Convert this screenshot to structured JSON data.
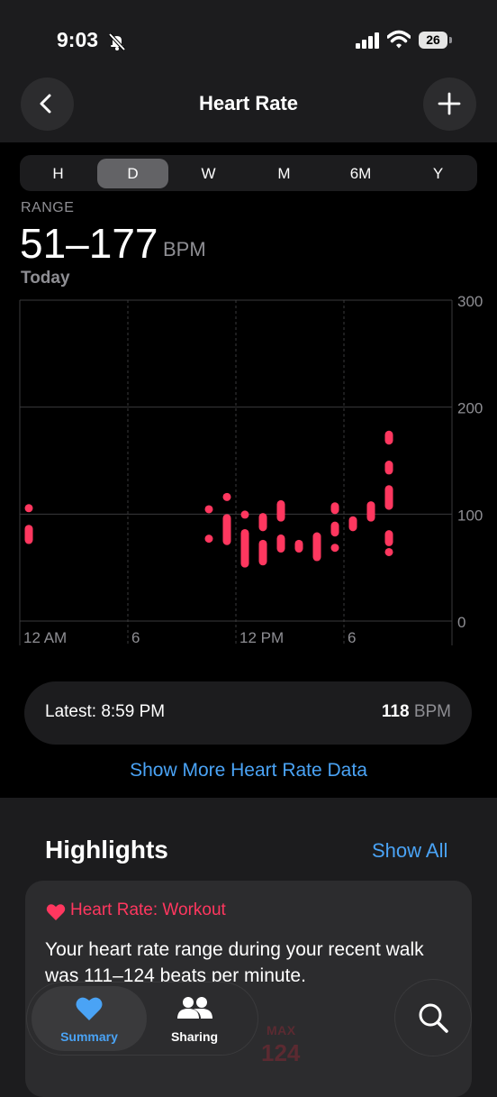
{
  "status_bar": {
    "time": "9:03",
    "battery": "26"
  },
  "nav": {
    "title": "Heart Rate"
  },
  "segments": [
    "H",
    "D",
    "W",
    "M",
    "6M",
    "Y"
  ],
  "active_segment": "D",
  "range": {
    "label": "RANGE",
    "value": "51–177",
    "unit": "BPM",
    "date": "Today"
  },
  "chart_data": {
    "type": "range-bar",
    "x_labels": [
      "12 AM",
      "6",
      "12 PM",
      "6"
    ],
    "y_ticks": [
      0,
      100,
      200,
      300
    ],
    "ylim": [
      0,
      300
    ],
    "color": "#ff375f",
    "hour_values": [
      {
        "hour": 0.5,
        "min": 72,
        "max": 90
      },
      {
        "hour": 0.5,
        "min": 103,
        "max": 108
      },
      {
        "hour": 10.5,
        "min": 74,
        "max": 80
      },
      {
        "hour": 10.5,
        "min": 101,
        "max": 108
      },
      {
        "hour": 11.5,
        "min": 71,
        "max": 100
      },
      {
        "hour": 11.5,
        "min": 113,
        "max": 119
      },
      {
        "hour": 12.5,
        "min": 50,
        "max": 86
      },
      {
        "hour": 12.5,
        "min": 96,
        "max": 103
      },
      {
        "hour": 13.5,
        "min": 52,
        "max": 76
      },
      {
        "hour": 13.5,
        "min": 84,
        "max": 101
      },
      {
        "hour": 14.5,
        "min": 64,
        "max": 81
      },
      {
        "hour": 14.5,
        "min": 93,
        "max": 113
      },
      {
        "hour": 15.5,
        "min": 64,
        "max": 76
      },
      {
        "hour": 16.5,
        "min": 56,
        "max": 83
      },
      {
        "hour": 17.5,
        "min": 65,
        "max": 72
      },
      {
        "hour": 17.5,
        "min": 79,
        "max": 93
      },
      {
        "hour": 17.5,
        "min": 100,
        "max": 111
      },
      {
        "hour": 18.5,
        "min": 84,
        "max": 98
      },
      {
        "hour": 19.5,
        "min": 93,
        "max": 112
      },
      {
        "hour": 20.5,
        "min": 62,
        "max": 67
      },
      {
        "hour": 20.5,
        "min": 70,
        "max": 85
      },
      {
        "hour": 20.5,
        "min": 104,
        "max": 127
      },
      {
        "hour": 20.5,
        "min": 137,
        "max": 150
      },
      {
        "hour": 20.5,
        "min": 165,
        "max": 178
      }
    ]
  },
  "latest": {
    "label": "Latest: 8:59 PM",
    "value": "118",
    "unit": "BPM"
  },
  "more_link": "Show More Heart Rate Data",
  "highlights": {
    "title": "Highlights",
    "show_all": "Show All",
    "card": {
      "category": "Heart Rate: Workout",
      "description": "Your heart rate range during your recent walk was 111–124 beats per minute.",
      "max_label": "MAX",
      "max_value": "124"
    }
  },
  "tabbar": {
    "summary": "Summary",
    "sharing": "Sharing"
  },
  "colors": {
    "accent": "#4aa3f5",
    "heart": "#ff375f"
  }
}
